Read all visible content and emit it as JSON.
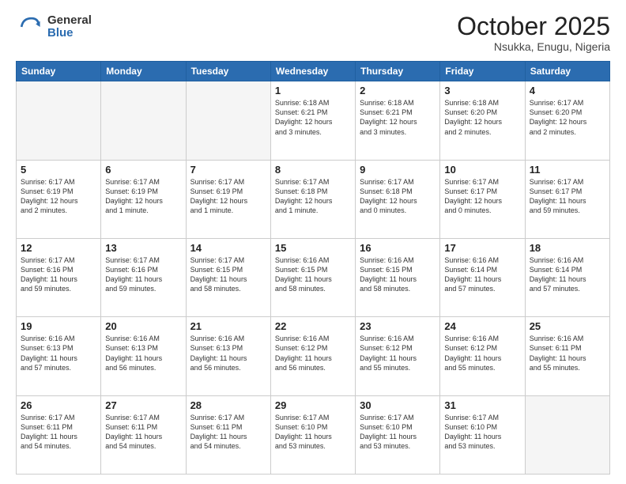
{
  "logo": {
    "general": "General",
    "blue": "Blue"
  },
  "header": {
    "month": "October 2025",
    "location": "Nsukka, Enugu, Nigeria"
  },
  "weekdays": [
    "Sunday",
    "Monday",
    "Tuesday",
    "Wednesday",
    "Thursday",
    "Friday",
    "Saturday"
  ],
  "weeks": [
    [
      {
        "day": "",
        "info": ""
      },
      {
        "day": "",
        "info": ""
      },
      {
        "day": "",
        "info": ""
      },
      {
        "day": "1",
        "info": "Sunrise: 6:18 AM\nSunset: 6:21 PM\nDaylight: 12 hours\nand 3 minutes."
      },
      {
        "day": "2",
        "info": "Sunrise: 6:18 AM\nSunset: 6:21 PM\nDaylight: 12 hours\nand 3 minutes."
      },
      {
        "day": "3",
        "info": "Sunrise: 6:18 AM\nSunset: 6:20 PM\nDaylight: 12 hours\nand 2 minutes."
      },
      {
        "day": "4",
        "info": "Sunrise: 6:17 AM\nSunset: 6:20 PM\nDaylight: 12 hours\nand 2 minutes."
      }
    ],
    [
      {
        "day": "5",
        "info": "Sunrise: 6:17 AM\nSunset: 6:19 PM\nDaylight: 12 hours\nand 2 minutes."
      },
      {
        "day": "6",
        "info": "Sunrise: 6:17 AM\nSunset: 6:19 PM\nDaylight: 12 hours\nand 1 minute."
      },
      {
        "day": "7",
        "info": "Sunrise: 6:17 AM\nSunset: 6:19 PM\nDaylight: 12 hours\nand 1 minute."
      },
      {
        "day": "8",
        "info": "Sunrise: 6:17 AM\nSunset: 6:18 PM\nDaylight: 12 hours\nand 1 minute."
      },
      {
        "day": "9",
        "info": "Sunrise: 6:17 AM\nSunset: 6:18 PM\nDaylight: 12 hours\nand 0 minutes."
      },
      {
        "day": "10",
        "info": "Sunrise: 6:17 AM\nSunset: 6:17 PM\nDaylight: 12 hours\nand 0 minutes."
      },
      {
        "day": "11",
        "info": "Sunrise: 6:17 AM\nSunset: 6:17 PM\nDaylight: 11 hours\nand 59 minutes."
      }
    ],
    [
      {
        "day": "12",
        "info": "Sunrise: 6:17 AM\nSunset: 6:16 PM\nDaylight: 11 hours\nand 59 minutes."
      },
      {
        "day": "13",
        "info": "Sunrise: 6:17 AM\nSunset: 6:16 PM\nDaylight: 11 hours\nand 59 minutes."
      },
      {
        "day": "14",
        "info": "Sunrise: 6:17 AM\nSunset: 6:15 PM\nDaylight: 11 hours\nand 58 minutes."
      },
      {
        "day": "15",
        "info": "Sunrise: 6:16 AM\nSunset: 6:15 PM\nDaylight: 11 hours\nand 58 minutes."
      },
      {
        "day": "16",
        "info": "Sunrise: 6:16 AM\nSunset: 6:15 PM\nDaylight: 11 hours\nand 58 minutes."
      },
      {
        "day": "17",
        "info": "Sunrise: 6:16 AM\nSunset: 6:14 PM\nDaylight: 11 hours\nand 57 minutes."
      },
      {
        "day": "18",
        "info": "Sunrise: 6:16 AM\nSunset: 6:14 PM\nDaylight: 11 hours\nand 57 minutes."
      }
    ],
    [
      {
        "day": "19",
        "info": "Sunrise: 6:16 AM\nSunset: 6:13 PM\nDaylight: 11 hours\nand 57 minutes."
      },
      {
        "day": "20",
        "info": "Sunrise: 6:16 AM\nSunset: 6:13 PM\nDaylight: 11 hours\nand 56 minutes."
      },
      {
        "day": "21",
        "info": "Sunrise: 6:16 AM\nSunset: 6:13 PM\nDaylight: 11 hours\nand 56 minutes."
      },
      {
        "day": "22",
        "info": "Sunrise: 6:16 AM\nSunset: 6:12 PM\nDaylight: 11 hours\nand 56 minutes."
      },
      {
        "day": "23",
        "info": "Sunrise: 6:16 AM\nSunset: 6:12 PM\nDaylight: 11 hours\nand 55 minutes."
      },
      {
        "day": "24",
        "info": "Sunrise: 6:16 AM\nSunset: 6:12 PM\nDaylight: 11 hours\nand 55 minutes."
      },
      {
        "day": "25",
        "info": "Sunrise: 6:16 AM\nSunset: 6:11 PM\nDaylight: 11 hours\nand 55 minutes."
      }
    ],
    [
      {
        "day": "26",
        "info": "Sunrise: 6:17 AM\nSunset: 6:11 PM\nDaylight: 11 hours\nand 54 minutes."
      },
      {
        "day": "27",
        "info": "Sunrise: 6:17 AM\nSunset: 6:11 PM\nDaylight: 11 hours\nand 54 minutes."
      },
      {
        "day": "28",
        "info": "Sunrise: 6:17 AM\nSunset: 6:11 PM\nDaylight: 11 hours\nand 54 minutes."
      },
      {
        "day": "29",
        "info": "Sunrise: 6:17 AM\nSunset: 6:10 PM\nDaylight: 11 hours\nand 53 minutes."
      },
      {
        "day": "30",
        "info": "Sunrise: 6:17 AM\nSunset: 6:10 PM\nDaylight: 11 hours\nand 53 minutes."
      },
      {
        "day": "31",
        "info": "Sunrise: 6:17 AM\nSunset: 6:10 PM\nDaylight: 11 hours\nand 53 minutes."
      },
      {
        "day": "",
        "info": ""
      }
    ]
  ]
}
